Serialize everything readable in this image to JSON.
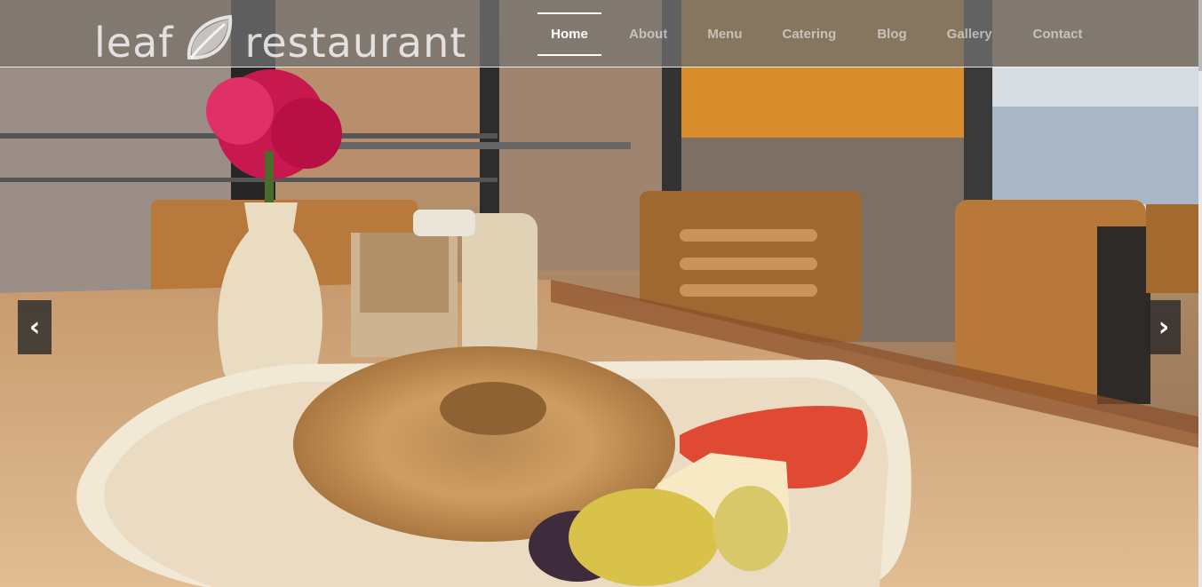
{
  "brand": {
    "name_left": "leaf",
    "name_right": "restaurant",
    "icon": "leaf-icon"
  },
  "nav": {
    "items": [
      {
        "label": "Home",
        "active": true
      },
      {
        "label": "About",
        "active": false
      },
      {
        "label": "Menu",
        "active": false
      },
      {
        "label": "Catering",
        "active": false
      },
      {
        "label": "Blog",
        "active": false
      },
      {
        "label": "Gallery",
        "active": false
      },
      {
        "label": "Contact",
        "active": false
      }
    ]
  },
  "slider": {
    "prev_glyph": "‹",
    "next_glyph": "›",
    "prev_icon": "chevron-left-icon",
    "next_icon": "chevron-right-icon"
  },
  "colors": {
    "nav_bg": "#6e6e6e",
    "nav_active": "#ffffff",
    "nav_inactive": "#b8b8b8"
  }
}
